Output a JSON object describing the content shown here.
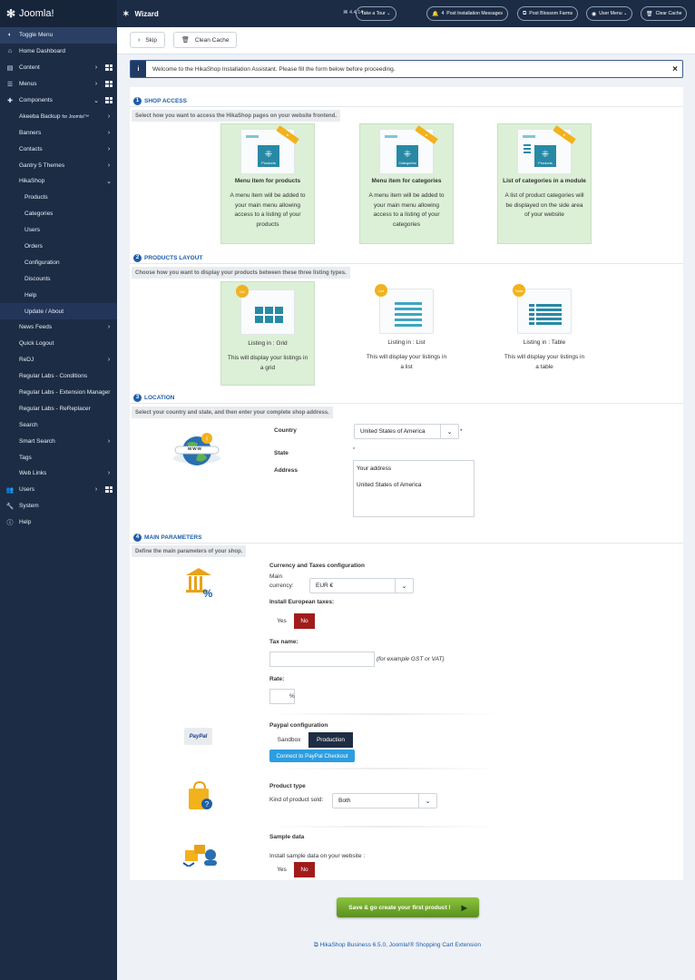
{
  "sidebar": {
    "logo": "Joomla!",
    "items": [
      {
        "label": "Toggle Menu",
        "icon": "toggle-icon"
      },
      {
        "label": "Home Dashboard",
        "icon": "home-icon"
      },
      {
        "label": "Content",
        "icon": "file-icon"
      },
      {
        "label": "Menus",
        "icon": "list-icon"
      },
      {
        "label": "Components",
        "icon": "puzzle-icon"
      },
      {
        "label": "Akeeba Backup",
        "suffix": "for Joomla!™"
      },
      {
        "label": "Banners"
      },
      {
        "label": "Contacts"
      },
      {
        "label": "Gantry 5 Themes"
      },
      {
        "label": "HikaShop"
      },
      {
        "label": "Products"
      },
      {
        "label": "Categories"
      },
      {
        "label": "Users"
      },
      {
        "label": "Orders"
      },
      {
        "label": "Configuration"
      },
      {
        "label": "Discounts"
      },
      {
        "label": "Help"
      },
      {
        "label": "Update / About"
      },
      {
        "label": "News Feeds"
      },
      {
        "label": "Quick Logout"
      },
      {
        "label": "ReDJ"
      },
      {
        "label": "Regular Labs - Conditions"
      },
      {
        "label": "Regular Labs - Extension Manager"
      },
      {
        "label": "Regular Labs - ReReplacer"
      },
      {
        "label": "Search"
      },
      {
        "label": "Smart Search"
      },
      {
        "label": "Tags"
      },
      {
        "label": "Web Links"
      },
      {
        "label": "Users",
        "icon": "users-icon"
      },
      {
        "label": "System",
        "icon": "wrench-icon"
      },
      {
        "label": "Help",
        "icon": "info-icon"
      }
    ]
  },
  "topbar": {
    "title": "Wizard",
    "version": "4.4.14",
    "buttons": {
      "tour": "Take a Tour",
      "messages_count": "4",
      "messages": "Post Installation Messages",
      "site": "Post Blossom Farms",
      "user": "User Menu",
      "cache": "Clear Cache"
    }
  },
  "toolbar": {
    "skip": "Skip",
    "clean_cache": "Clean Cache"
  },
  "message": "Welcome to the HikaShop Installation Assistant. Please fill the form below before proceeding.",
  "sections": {
    "shop_access": {
      "num": "1",
      "title": "SHOP ACCESS",
      "desc": "Select how you want to access the HikaShop pages on your website frontend.",
      "cards": [
        {
          "thumb": "Products",
          "title": "Menu item for products",
          "desc": "A menu item will be added to your main menu allowing access to a listing of your products"
        },
        {
          "thumb": "Categories",
          "title": "Menu item for categories",
          "desc": "A menu item will be added to your main menu allowing access to a listing of your categories"
        },
        {
          "thumb": "Products",
          "title": "List of categories in a module",
          "desc": "A list of product categories will be displayed on the side area of your website"
        }
      ]
    },
    "layout": {
      "num": "2",
      "title": "PRODUCTS LAYOUT",
      "desc": "Choose how you want to display your products between these three listing types.",
      "cards": [
        {
          "tag": "Div",
          "title": "Listing in : Grid",
          "desc": "This will display your listings in a grid"
        },
        {
          "tag": "List",
          "title": "Listing in : List",
          "desc": "This will display your listings in a list"
        },
        {
          "tag": "Table",
          "title": "Listing in : Table",
          "desc": "This will display your listings in a table"
        }
      ]
    },
    "location": {
      "num": "3",
      "title": "LOCATION",
      "desc": "Select your country and state, and then enter your complete shop address.",
      "country_label": "Country",
      "country_value": "United States of America",
      "required_mark": "*",
      "state_label": "State",
      "state_value": "*",
      "address_label": "Address",
      "address_value": "Your address\n\nUnited States of America",
      "globe_text": "www"
    },
    "main": {
      "num": "4",
      "title": "MAIN PARAMETERS",
      "desc": "Define the main parameters of your shop.",
      "currency_title": "Currency and Taxes configuration",
      "main_currency_label": "Main currency:",
      "main_currency_value": "EUR €",
      "eu_taxes_label": "Install European taxes:",
      "yes": "Yes",
      "no": "No",
      "tax_name_label": "Tax name:",
      "tax_name_hint": "(for example GST or VAT)",
      "rate_label": "Rate:",
      "rate_unit": "%",
      "paypal_title": "Paypal configuration",
      "paypal_logo": "PayPal",
      "sandbox": "Sandbox",
      "production": "Production",
      "paypal_connect": "Connect to PayPal Checkout",
      "product_type_title": "Product type",
      "product_kind_label": "Kind of product sold:",
      "product_kind_value": "Both",
      "sample_title": "Sample data",
      "sample_label": "Install sample data on your website :"
    }
  },
  "save_button": "Save & go create your first product !",
  "footer": "HikaShop Business 6.5.0, Joomla!® Shopping Cart Extension",
  "colors": {
    "sidebar": "#1c2c45",
    "accent": "#1f5ea8",
    "selected_card": "#dcefd7",
    "no_active": "#a01c1c",
    "save": "#6fa52a"
  }
}
